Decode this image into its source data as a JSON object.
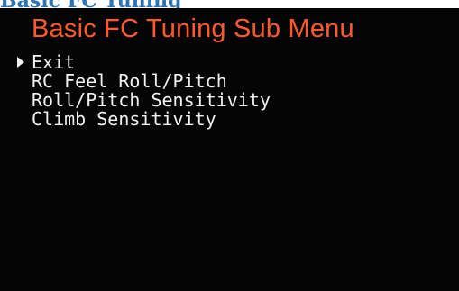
{
  "doc_heading": "Basic FC Tuning",
  "osd": {
    "title": "Basic FC Tuning Sub Menu",
    "menu": [
      {
        "label": "Exit",
        "selected": true
      },
      {
        "label": "RC Feel Roll/Pitch",
        "selected": false
      },
      {
        "label": "Roll/Pitch Sensitivity",
        "selected": false
      },
      {
        "label": "Climb Sensitivity",
        "selected": false
      }
    ],
    "cursor_icon": "triangle-right-icon",
    "colors": {
      "title": "#ff5a2a",
      "text": "#f2f2f2",
      "background": "#050505",
      "doc_heading": "#2e74b5"
    }
  }
}
